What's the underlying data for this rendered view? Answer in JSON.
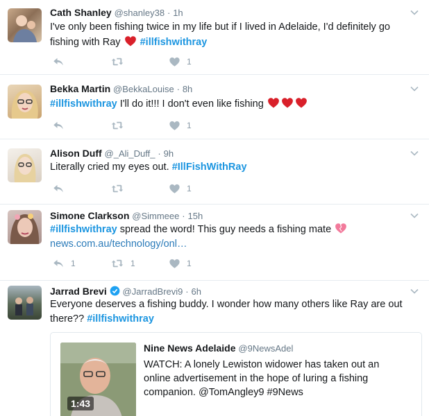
{
  "tweets": [
    {
      "name": "Cath Shanley",
      "handle": "@shanley38",
      "time": "1h",
      "text_a": "I've only been fishing twice in my life but if I lived in Adelaide, I'd definitely go fishing with Ray ",
      "hashtag": "#illfishwithray",
      "replies": "",
      "retweets": "",
      "likes": "1"
    },
    {
      "name": "Bekka Martin",
      "handle": "@BekkaLouise",
      "time": "8h",
      "hashtag": "#illfishwithray",
      "text_b": " I'll do it!!! I don't even like fishing ",
      "replies": "",
      "retweets": "",
      "likes": "1"
    },
    {
      "name": "Alison Duff",
      "handle": "@_Ali_Duff_",
      "time": "9h",
      "text_a": "Literally cried my eyes out. ",
      "hashtag": "#IllFishWithRay",
      "replies": "",
      "retweets": "",
      "likes": "1"
    },
    {
      "name": "Simone Clarkson",
      "handle": "@Simmeee",
      "time": "15h",
      "hashtag": "#illfishwithray",
      "text_b": " spread the word! This guy needs a fishing mate ",
      "link": "news.com.au/technology/onl…",
      "replies": "1",
      "retweets": "1",
      "likes": "1"
    },
    {
      "name": "Jarrad Brevi",
      "handle": "@JarradBrevi9",
      "time": "6h",
      "text_a": "Everyone deserves a fishing buddy. I wonder how many others like Ray are out there?? ",
      "hashtag": "#illfishwithray"
    }
  ],
  "quoted": {
    "name": "Nine News Adelaide",
    "handle": "@9NewsAdel",
    "text": "WATCH: A lonely Lewiston widower has taken out an online advertisement in the hope of luring a fishing companion. @TomAngley9 #9News",
    "duration": "1:43"
  },
  "separator": "·",
  "colors": {
    "accent": "#1b95e0",
    "heart": "#e0245e",
    "muted": "#657786",
    "icon": "#aab8c2"
  },
  "icons": [
    "reply-icon",
    "retweet-icon",
    "like-icon",
    "chevron-down-icon",
    "verified-badge-icon",
    "red-heart-emoji"
  ]
}
